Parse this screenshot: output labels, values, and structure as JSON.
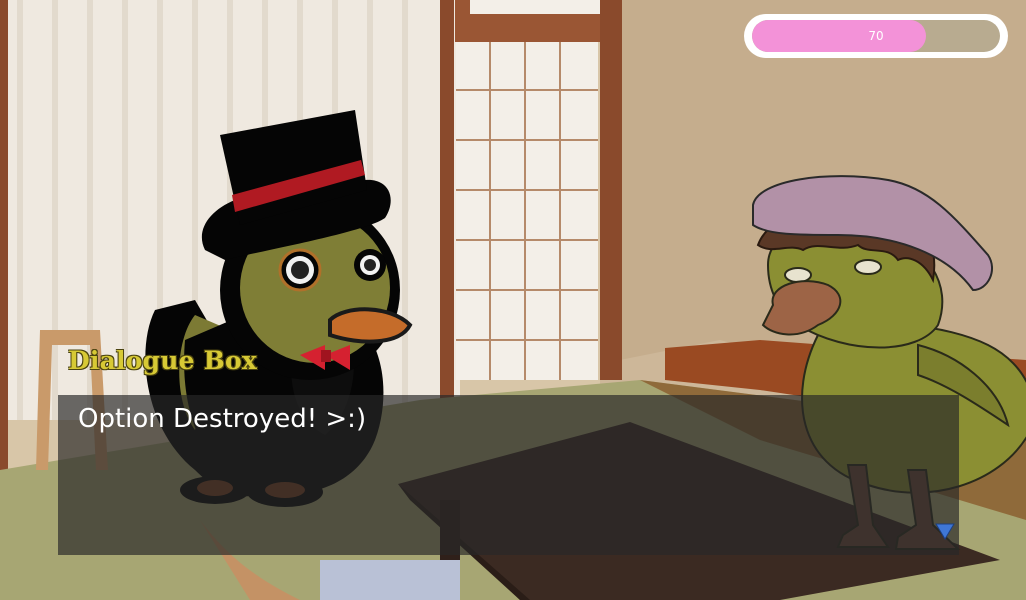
{
  "hud": {
    "progress_value": "70",
    "progress_fraction": 0.7
  },
  "dialogue": {
    "speaker": "Dialogue Box",
    "text": "Option Destroyed! >:)"
  },
  "colors": {
    "progress_fill": "#f392d8",
    "name_text": "#d7c935",
    "panel": "#282828"
  },
  "icons": {
    "advance": "triangle-down-icon"
  }
}
